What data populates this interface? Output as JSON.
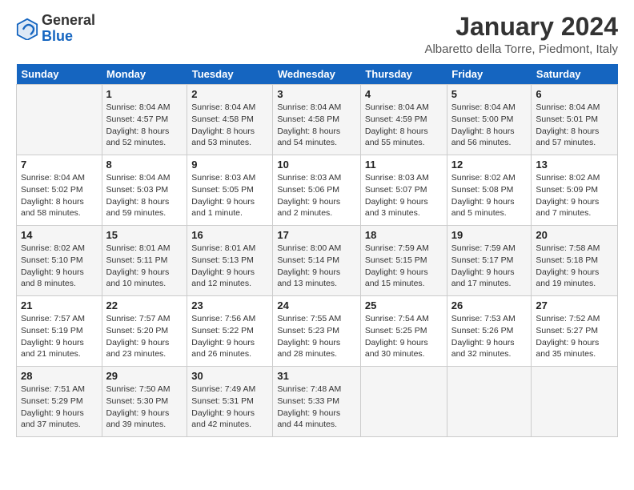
{
  "header": {
    "logo": {
      "general": "General",
      "blue": "Blue"
    },
    "title": "January 2024",
    "location": "Albaretto della Torre, Piedmont, Italy"
  },
  "days_of_week": [
    "Sunday",
    "Monday",
    "Tuesday",
    "Wednesday",
    "Thursday",
    "Friday",
    "Saturday"
  ],
  "weeks": [
    [
      {
        "day": "",
        "info": ""
      },
      {
        "day": "1",
        "info": "Sunrise: 8:04 AM\nSunset: 4:57 PM\nDaylight: 8 hours\nand 52 minutes."
      },
      {
        "day": "2",
        "info": "Sunrise: 8:04 AM\nSunset: 4:58 PM\nDaylight: 8 hours\nand 53 minutes."
      },
      {
        "day": "3",
        "info": "Sunrise: 8:04 AM\nSunset: 4:58 PM\nDaylight: 8 hours\nand 54 minutes."
      },
      {
        "day": "4",
        "info": "Sunrise: 8:04 AM\nSunset: 4:59 PM\nDaylight: 8 hours\nand 55 minutes."
      },
      {
        "day": "5",
        "info": "Sunrise: 8:04 AM\nSunset: 5:00 PM\nDaylight: 8 hours\nand 56 minutes."
      },
      {
        "day": "6",
        "info": "Sunrise: 8:04 AM\nSunset: 5:01 PM\nDaylight: 8 hours\nand 57 minutes."
      }
    ],
    [
      {
        "day": "7",
        "info": "Sunrise: 8:04 AM\nSunset: 5:02 PM\nDaylight: 8 hours\nand 58 minutes."
      },
      {
        "day": "8",
        "info": "Sunrise: 8:04 AM\nSunset: 5:03 PM\nDaylight: 8 hours\nand 59 minutes."
      },
      {
        "day": "9",
        "info": "Sunrise: 8:03 AM\nSunset: 5:05 PM\nDaylight: 9 hours\nand 1 minute."
      },
      {
        "day": "10",
        "info": "Sunrise: 8:03 AM\nSunset: 5:06 PM\nDaylight: 9 hours\nand 2 minutes."
      },
      {
        "day": "11",
        "info": "Sunrise: 8:03 AM\nSunset: 5:07 PM\nDaylight: 9 hours\nand 3 minutes."
      },
      {
        "day": "12",
        "info": "Sunrise: 8:02 AM\nSunset: 5:08 PM\nDaylight: 9 hours\nand 5 minutes."
      },
      {
        "day": "13",
        "info": "Sunrise: 8:02 AM\nSunset: 5:09 PM\nDaylight: 9 hours\nand 7 minutes."
      }
    ],
    [
      {
        "day": "14",
        "info": "Sunrise: 8:02 AM\nSunset: 5:10 PM\nDaylight: 9 hours\nand 8 minutes."
      },
      {
        "day": "15",
        "info": "Sunrise: 8:01 AM\nSunset: 5:11 PM\nDaylight: 9 hours\nand 10 minutes."
      },
      {
        "day": "16",
        "info": "Sunrise: 8:01 AM\nSunset: 5:13 PM\nDaylight: 9 hours\nand 12 minutes."
      },
      {
        "day": "17",
        "info": "Sunrise: 8:00 AM\nSunset: 5:14 PM\nDaylight: 9 hours\nand 13 minutes."
      },
      {
        "day": "18",
        "info": "Sunrise: 7:59 AM\nSunset: 5:15 PM\nDaylight: 9 hours\nand 15 minutes."
      },
      {
        "day": "19",
        "info": "Sunrise: 7:59 AM\nSunset: 5:17 PM\nDaylight: 9 hours\nand 17 minutes."
      },
      {
        "day": "20",
        "info": "Sunrise: 7:58 AM\nSunset: 5:18 PM\nDaylight: 9 hours\nand 19 minutes."
      }
    ],
    [
      {
        "day": "21",
        "info": "Sunrise: 7:57 AM\nSunset: 5:19 PM\nDaylight: 9 hours\nand 21 minutes."
      },
      {
        "day": "22",
        "info": "Sunrise: 7:57 AM\nSunset: 5:20 PM\nDaylight: 9 hours\nand 23 minutes."
      },
      {
        "day": "23",
        "info": "Sunrise: 7:56 AM\nSunset: 5:22 PM\nDaylight: 9 hours\nand 26 minutes."
      },
      {
        "day": "24",
        "info": "Sunrise: 7:55 AM\nSunset: 5:23 PM\nDaylight: 9 hours\nand 28 minutes."
      },
      {
        "day": "25",
        "info": "Sunrise: 7:54 AM\nSunset: 5:25 PM\nDaylight: 9 hours\nand 30 minutes."
      },
      {
        "day": "26",
        "info": "Sunrise: 7:53 AM\nSunset: 5:26 PM\nDaylight: 9 hours\nand 32 minutes."
      },
      {
        "day": "27",
        "info": "Sunrise: 7:52 AM\nSunset: 5:27 PM\nDaylight: 9 hours\nand 35 minutes."
      }
    ],
    [
      {
        "day": "28",
        "info": "Sunrise: 7:51 AM\nSunset: 5:29 PM\nDaylight: 9 hours\nand 37 minutes."
      },
      {
        "day": "29",
        "info": "Sunrise: 7:50 AM\nSunset: 5:30 PM\nDaylight: 9 hours\nand 39 minutes."
      },
      {
        "day": "30",
        "info": "Sunrise: 7:49 AM\nSunset: 5:31 PM\nDaylight: 9 hours\nand 42 minutes."
      },
      {
        "day": "31",
        "info": "Sunrise: 7:48 AM\nSunset: 5:33 PM\nDaylight: 9 hours\nand 44 minutes."
      },
      {
        "day": "",
        "info": ""
      },
      {
        "day": "",
        "info": ""
      },
      {
        "day": "",
        "info": ""
      }
    ]
  ]
}
